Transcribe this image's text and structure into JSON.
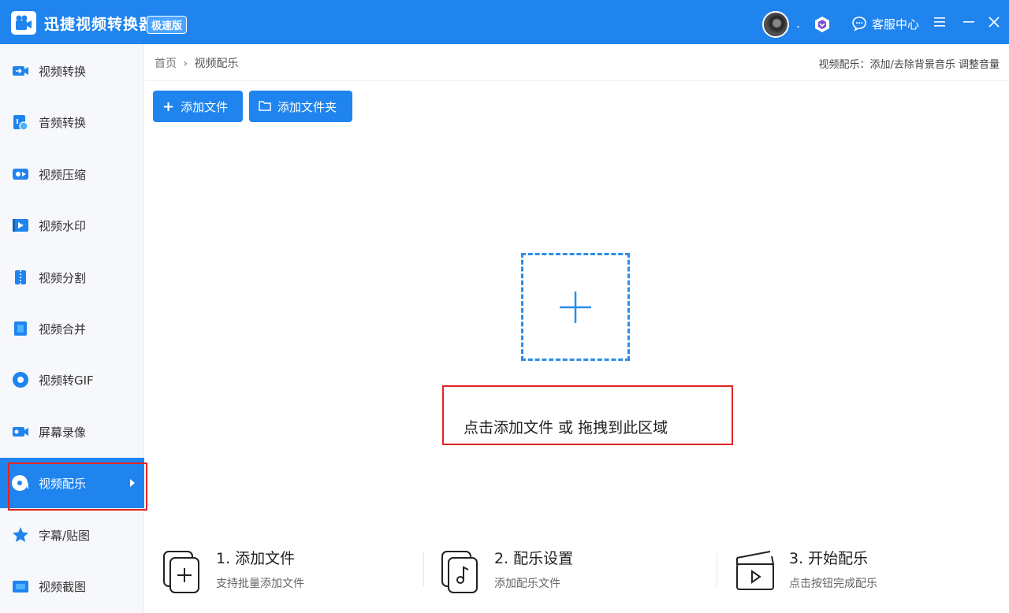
{
  "app": {
    "title": "迅捷视频转换器",
    "edition": "极速版",
    "service_label": "客服中心",
    "dot": "."
  },
  "sidebar": {
    "items": [
      {
        "label": "视频转换",
        "icon": "video-convert-icon",
        "active": false
      },
      {
        "label": "音频转换",
        "icon": "audio-convert-icon",
        "active": false
      },
      {
        "label": "视频压缩",
        "icon": "video-compress-icon",
        "active": false
      },
      {
        "label": "视频水印",
        "icon": "video-watermark-icon",
        "active": false
      },
      {
        "label": "视频分割",
        "icon": "video-split-icon",
        "active": false
      },
      {
        "label": "视频合并",
        "icon": "video-merge-icon",
        "active": false
      },
      {
        "label": "视频转GIF",
        "icon": "video-gif-icon",
        "active": false
      },
      {
        "label": "屏幕录像",
        "icon": "screen-record-icon",
        "active": false
      },
      {
        "label": "视频配乐",
        "icon": "video-music-icon",
        "active": true
      },
      {
        "label": "字幕/贴图",
        "icon": "subtitle-sticker-icon",
        "active": false
      },
      {
        "label": "视频截图",
        "icon": "video-screenshot-icon",
        "active": false
      }
    ]
  },
  "breadcrumb": {
    "home": "首页",
    "separator": "›",
    "current": "视频配乐"
  },
  "hint": "视频配乐：添加/去除背景音乐 调整音量",
  "toolbar": {
    "add_file": "添加文件",
    "add_folder": "添加文件夹"
  },
  "drop_zone": {
    "text": "点击添加文件 或 拖拽到此区域"
  },
  "steps": [
    {
      "title": "1. 添加文件",
      "desc": "支持批量添加文件",
      "icon": "add-file-icon"
    },
    {
      "title": "2. 配乐设置",
      "desc": "添加配乐文件",
      "icon": "music-settings-icon"
    },
    {
      "title": "3. 开始配乐",
      "desc": "点击按钮完成配乐",
      "icon": "start-music-icon"
    }
  ],
  "colors": {
    "primary": "#1f84ee",
    "highlight": "#e02424",
    "dash": "#2b8fe8"
  }
}
